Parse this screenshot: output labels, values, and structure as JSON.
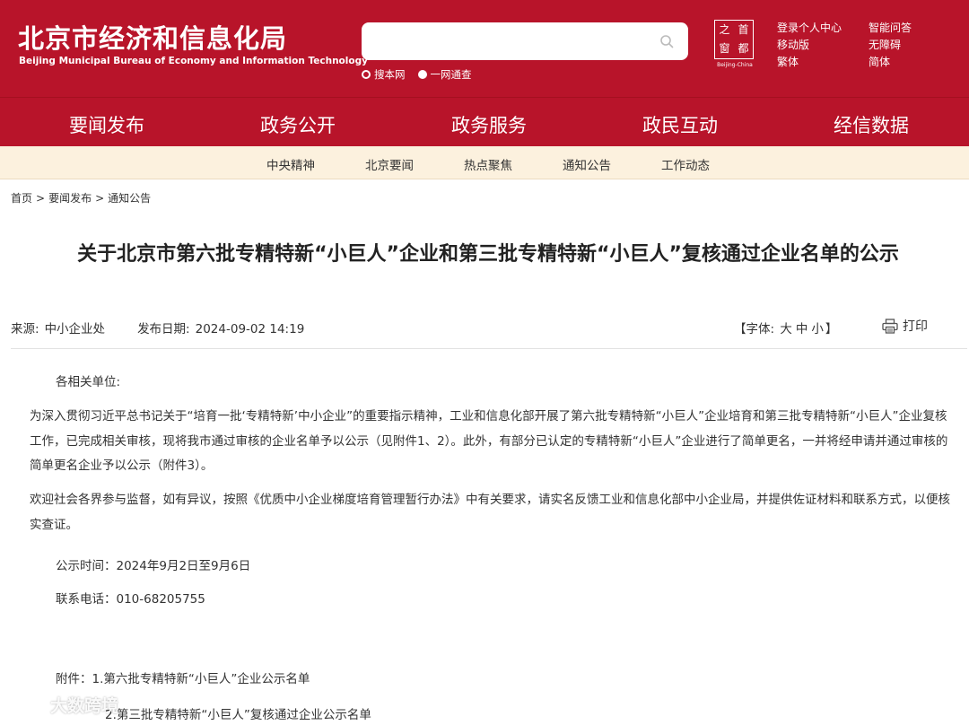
{
  "header": {
    "logo_cn": "北京市经济和信息化局",
    "logo_en": "Beijing Municipal Bureau of Economy and Information Technology",
    "search_placeholder": "",
    "search_options": [
      "搜本网",
      "一网通查"
    ],
    "capital_logo": {
      "chars": [
        "之",
        "首",
        "窗",
        "都"
      ],
      "subtitle": "Beijing-China"
    },
    "quick_links": [
      "登录个人中心",
      "智能问答",
      "移动版",
      "无障碍",
      "繁体",
      "简体"
    ]
  },
  "main_nav": [
    "要闻发布",
    "政务公开",
    "政务服务",
    "政民互动",
    "经信数据"
  ],
  "sub_nav": [
    "中央精神",
    "北京要闻",
    "热点聚焦",
    "通知公告",
    "工作动态"
  ],
  "breadcrumb": [
    "首页",
    "要闻发布",
    "通知公告"
  ],
  "article": {
    "title": "关于北京市第六批专精特新“小巨人”企业和第三批专精特新“小巨人”复核通过企业名单的公示",
    "source_label": "来源:",
    "source": "中小企业处",
    "date_label": "发布日期:",
    "date": "2024-09-02 14:19",
    "font_label": "【字体:",
    "font_sizes": [
      "大",
      "中",
      "小"
    ],
    "font_close": "】",
    "print_label": "打印",
    "salutation": "各相关单位:",
    "paragraphs": [
      "为深入贯彻习近平总书记关于“培育一批‘专精特新’中小企业”的重要指示精神，工业和信息化部开展了第六批专精特新“小巨人”企业培育和第三批专精特新“小巨人”企业复核工作，已完成相关审核，现将我市通过审核的企业名单予以公示（见附件1、2）。此外，有部分已认定的专精特新“小巨人”企业进行了简单更名，一并将经申请并通过审核的简单更名企业予以公示（附件3）。",
      "欢迎社会各界参与监督，如有异议，按照《优质中小企业梯度培育管理暂行办法》中有关要求，请实名反馈工业和信息化部中小企业局，并提供佐证材料和联系方式，以便核实查证。"
    ],
    "notice_period": "公示时间：2024年9月2日至9月6日",
    "contact": "联系电话：010-68205755",
    "attachments": [
      "附件：1.第六批专精特新“小巨人”企业公示名单",
      "2.第三批专精特新“小巨人”复核通过企业公示名单"
    ]
  },
  "watermark": "大数跨境"
}
